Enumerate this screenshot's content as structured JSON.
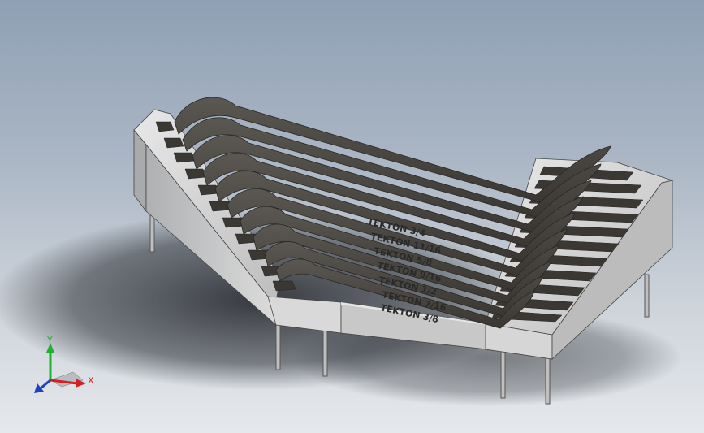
{
  "viewport": {
    "background_top": "#8fa0b4",
    "background_bottom": "#e6e9ec"
  },
  "model": {
    "engravings": [
      "TEKTON 3/4",
      "TEKTON 11/16",
      "TEKTON 5/8",
      "TEKTON 9/16",
      "TEKTON 1/2",
      "TEKTON 7/16",
      "TEKTON 3/8"
    ],
    "body_color": "#c9c9c9",
    "slot_color": "#3b3834",
    "wrench_color": "#4a4641"
  },
  "triad": {
    "x_label": "X",
    "y_label": "Y",
    "z_label": "Z",
    "x_color": "#d42020",
    "y_color": "#20b030",
    "z_color": "#2040c0"
  }
}
